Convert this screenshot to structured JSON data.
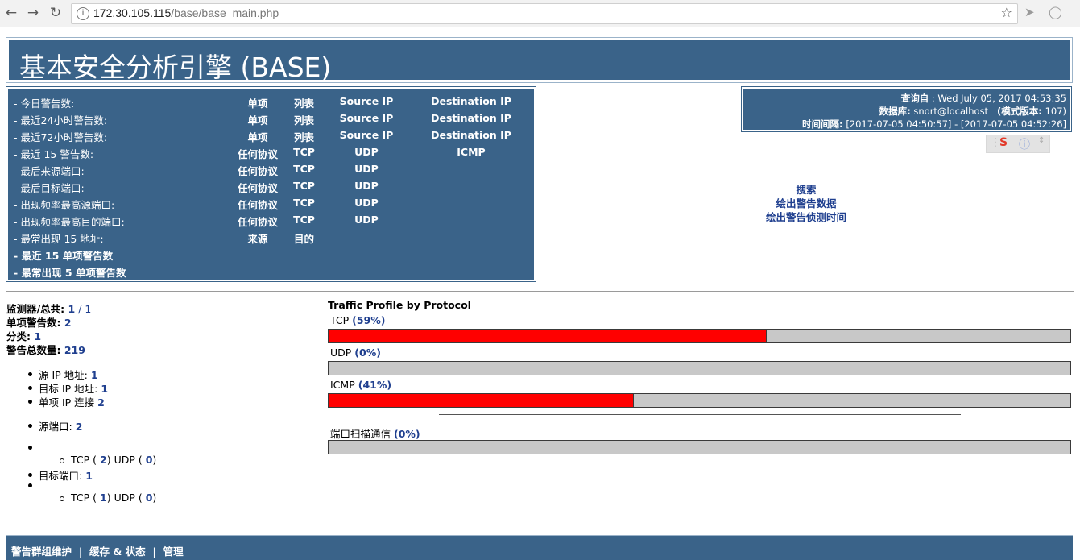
{
  "browser": {
    "url_host": "172.30.105.115",
    "url_path": "/base/base_main.php"
  },
  "banner": {
    "title": "基本安全分析引擎 (BASE)"
  },
  "menu": {
    "rows": [
      {
        "label": "- 今日警告数:",
        "c1": "单项",
        "c2": "列表",
        "c3": "Source IP",
        "c4": "Destination IP"
      },
      {
        "label": "- 最近24小时警告数:",
        "c1": "单项",
        "c2": "列表",
        "c3": "Source IP",
        "c4": "Destination IP"
      },
      {
        "label": "- 最近72小时警告数:",
        "c1": "单项",
        "c2": "列表",
        "c3": "Source IP",
        "c4": "Destination IP"
      },
      {
        "label": "- 最近 15 警告数:",
        "c1": "任何协议",
        "c2": "TCP",
        "c3": "UDP",
        "c4": "ICMP"
      },
      {
        "label": "- 最后来源端口:",
        "c1": "任何协议",
        "c2": "TCP",
        "c3": "UDP",
        "c4": ""
      },
      {
        "label": "- 最后目标端口:",
        "c1": "任何协议",
        "c2": "TCP",
        "c3": "UDP",
        "c4": ""
      },
      {
        "label": "- 出现频率最高源端口:",
        "c1": "任何协议",
        "c2": "TCP",
        "c3": "UDP",
        "c4": ""
      },
      {
        "label": "- 出现频率最高目的端口:",
        "c1": "任何协议",
        "c2": "TCP",
        "c3": "UDP",
        "c4": ""
      },
      {
        "label": "- 最常出现 15 地址:",
        "c1": "来源",
        "c2": "目的",
        "c3": "",
        "c4": ""
      },
      {
        "label": "- 最近 15 单项警告数",
        "c1": "",
        "c2": "",
        "c3": "",
        "c4": ""
      },
      {
        "label": "- 最常出现 5 单项警告数",
        "c1": "",
        "c2": "",
        "c3": "",
        "c4": ""
      }
    ]
  },
  "query_info": {
    "query_label": "查询自",
    "query_value": ": Wed July 05, 2017 04:53:35",
    "db_label": "数据库:",
    "db_value": "snort@localhost",
    "schema_label": "(模式版本:",
    "schema_value": "107)",
    "interval_label": "时间间隔:",
    "interval_value": "[2017-07-05 04:50:57] - [2017-07-05 04:52:26]"
  },
  "links": {
    "search": "搜索",
    "graph_alert_data": "绘出警告数据",
    "graph_alert_time": "绘出警告侦测时间"
  },
  "stats": {
    "sensors_label": "监测器/总共:",
    "sensors_value": "1",
    "sensors_sep": " / ",
    "sensors_total": "1",
    "unique_alerts_label": "单项警告数:",
    "unique_alerts_value": "2",
    "categories_label": "分类:",
    "categories_value": "1",
    "total_alerts_label": "警告总数量:",
    "total_alerts_value": "219",
    "src_ip_label": "源 IP 地址:",
    "src_ip_value": "1",
    "dst_ip_label": "目标 IP 地址:",
    "dst_ip_value": "1",
    "unique_ip_links_label": "单项 IP 连接",
    "unique_ip_links_value": "2",
    "src_ports_label": "源端口:",
    "src_ports_value": "2",
    "src_tcp_label": "TCP (",
    "src_tcp_value": "2",
    "src_udp_label": ")  UDP (",
    "src_udp_value": "0",
    "dst_ports_label": "目标端口:",
    "dst_ports_value": "1",
    "dst_tcp_label": "TCP (",
    "dst_tcp_value": "1",
    "dst_udp_label": ")  UDP (",
    "dst_udp_value": "0",
    "close_paren": ")"
  },
  "traffic": {
    "title": "Traffic Profile by Protocol",
    "protocols": [
      {
        "name": "TCP",
        "pct_text": "(59%)",
        "fraction": 0.59
      },
      {
        "name": "UDP",
        "pct_text": "(0%)",
        "fraction": 0.0
      },
      {
        "name": "ICMP",
        "pct_text": "(41%)",
        "fraction": 0.41
      }
    ],
    "portscan": {
      "name": "端口扫描通信",
      "pct_text": "(0%)",
      "fraction": 0.0
    }
  },
  "footer": {
    "item1": "警告群组维护",
    "sep": "|",
    "item2": "缓存 & 状态",
    "item3": "管理"
  },
  "colors": {
    "panel": "#3a6389",
    "bar_fill": "#ff0000",
    "bar_empty": "#c8c8c8",
    "link": "#1f3f8f"
  }
}
